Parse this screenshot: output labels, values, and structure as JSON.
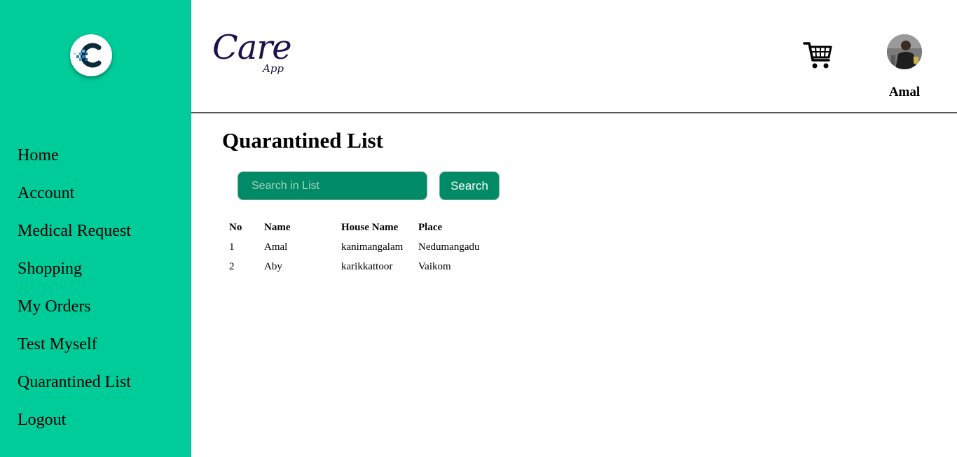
{
  "sidebar": {
    "logo_icon": "care-app-c-logo",
    "items": [
      {
        "label": "Home"
      },
      {
        "label": "Account"
      },
      {
        "label": "Medical Request"
      },
      {
        "label": "Shopping"
      },
      {
        "label": "My Orders"
      },
      {
        "label": "Test Myself"
      },
      {
        "label": "Quarantined List"
      },
      {
        "label": "Logout"
      }
    ]
  },
  "header": {
    "brand_main": "Care",
    "brand_sub": "App",
    "cart_icon": "shopping-cart-icon",
    "user_name": "Amal"
  },
  "main": {
    "title": "Quarantined List",
    "search": {
      "placeholder": "Search in List",
      "value": "",
      "button_label": "Search"
    },
    "table": {
      "headers": [
        "No",
        "Name",
        "House Name",
        "Place"
      ],
      "rows": [
        [
          "1",
          "Amal",
          "kanimangalam",
          "Nedumangadu"
        ],
        [
          "2",
          "Aby",
          "karikkattoor",
          "Vaikom"
        ]
      ]
    }
  },
  "colors": {
    "sidebar_bg": "#00cc99",
    "button_bg": "#008a65",
    "brand_text": "#1f0f4a"
  }
}
